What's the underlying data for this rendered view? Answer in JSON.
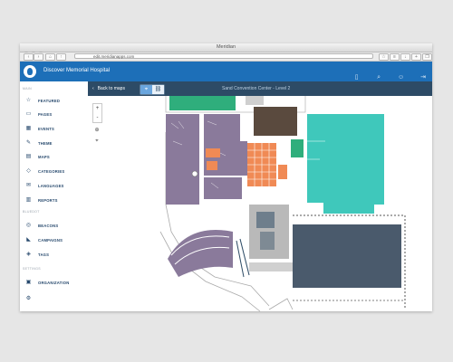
{
  "window": {
    "title": "Meridian"
  },
  "browser": {
    "url": "edit.meridianapps.com"
  },
  "header": {
    "app_title": "Discover Memorial Hospital",
    "icons": [
      "mobile-icon",
      "search-icon",
      "user-icon",
      "logout-icon"
    ]
  },
  "sidebar": {
    "sections": [
      "MAIN",
      "BLUEDOT",
      "SETTINGS"
    ],
    "items": [
      {
        "label": "FEATURED",
        "icon": "star-icon"
      },
      {
        "label": "PAGES",
        "icon": "page-icon"
      },
      {
        "label": "EVENTS",
        "icon": "calendar-icon"
      },
      {
        "label": "THEME",
        "icon": "theme-icon"
      },
      {
        "label": "MAPS",
        "icon": "map-icon"
      },
      {
        "label": "CATEGORIES",
        "icon": "tag-icon"
      },
      {
        "label": "LANGUAGES",
        "icon": "language-icon"
      },
      {
        "label": "REPORTS",
        "icon": "reports-icon"
      },
      {
        "label": "BEACONS",
        "icon": "beacon-icon"
      },
      {
        "label": "CAMPAIGNS",
        "icon": "megaphone-icon"
      },
      {
        "label": "TAGS",
        "icon": "tag-icon"
      },
      {
        "label": "ORGANIZATION",
        "icon": "organization-icon"
      }
    ]
  },
  "subbar": {
    "back_label": "Back to maps",
    "venue_title": "Sand Convention Center - Level 2"
  },
  "map": {
    "zoom_in": "+",
    "zoom_out": "-",
    "colors": {
      "purple": "#8a7a9b",
      "teal": "#3fc8bb",
      "orange": "#f08a55",
      "slate": "#4a5a6c",
      "green": "#2fae7c"
    }
  }
}
